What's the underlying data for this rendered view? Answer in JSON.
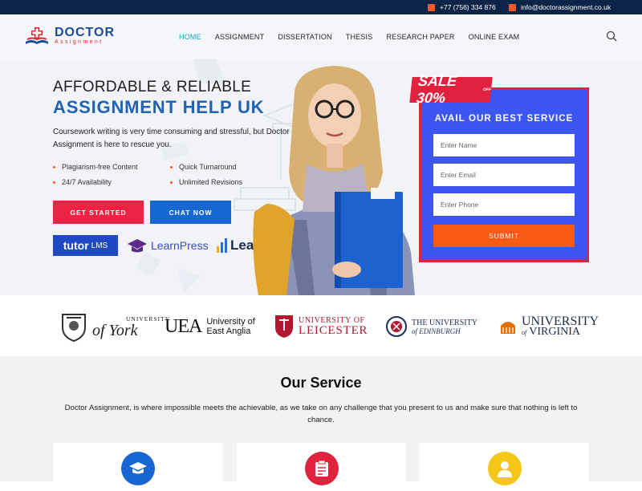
{
  "topbar": {
    "phone": "+77 (756) 334 876",
    "email": "info@doctorassignment.co.uk"
  },
  "brand": {
    "name_top": "DOCTOR",
    "name_bottom": "Assignment"
  },
  "nav": {
    "items": [
      {
        "label": "HOME",
        "active": true
      },
      {
        "label": "ASSIGNMENT",
        "active": false
      },
      {
        "label": "DISSERTATION",
        "active": false
      },
      {
        "label": "THESIS",
        "active": false
      },
      {
        "label": "RESEARCH PAPER",
        "active": false
      },
      {
        "label": "ONLINE EXAM",
        "active": false
      }
    ],
    "search_icon": "search-icon"
  },
  "hero": {
    "headline_1": "AFFORDABLE & RELIABLE",
    "headline_2": "ASSIGNMENT HELP UK",
    "description": "Coursework writing is very time consuming and stressful, but Doctor Assignment is here to rescue you.",
    "features": [
      "Plagiarism-free Content",
      "Quick Turnaround",
      "24/7 Availability",
      "Unlimited Revisions"
    ],
    "cta_primary": "GET STARTED",
    "cta_secondary": "CHAT NOW",
    "partners": {
      "tutor_bold": "tutor",
      "tutor_light": "LMS",
      "learnpress": "LearnPress",
      "learndash": "LearnDash"
    }
  },
  "offer": {
    "sale_label": "SALE 30%",
    "sale_small": "OFF",
    "form_title": "AVAIL OUR BEST SERVICE",
    "name_placeholder": "Enter Name",
    "email_placeholder": "Enter Email",
    "phone_placeholder": "Enter Phone",
    "submit_label": "SUBMIT"
  },
  "universities": {
    "york_top": "UNIVERSITY",
    "york_bottom": "of York",
    "uea_mark": "UEA",
    "uea_line1": "University of",
    "uea_line2": "East Anglia",
    "leicester_line1": "UNIVERSITY OF",
    "leicester_line2": "LEICESTER",
    "edinburgh_line1": "THE UNIVERSITY",
    "edinburgh_line2": "of EDINBURGH",
    "virginia_line1": "UNIVERSITY",
    "virginia_line2": "VIRGINIA",
    "virginia_of": "of"
  },
  "services": {
    "title": "Our Service",
    "description": "Doctor Assignment, is where impossible meets the achievable, as we take on any challenge that you present to us and make sure that nothing is left to chance.",
    "cards": [
      {
        "icon": "graduation-cap-icon",
        "color": "#1667d2"
      },
      {
        "icon": "clipboard-icon",
        "color": "#e0223f"
      },
      {
        "icon": "writer-icon",
        "color": "#f5c518"
      }
    ]
  },
  "colors": {
    "topbar": "#0b2447",
    "accent_blue": "#1e63b5",
    "accent_red": "#ec2342",
    "form_bg": "#3d56f2",
    "submit": "#fb5a12"
  }
}
